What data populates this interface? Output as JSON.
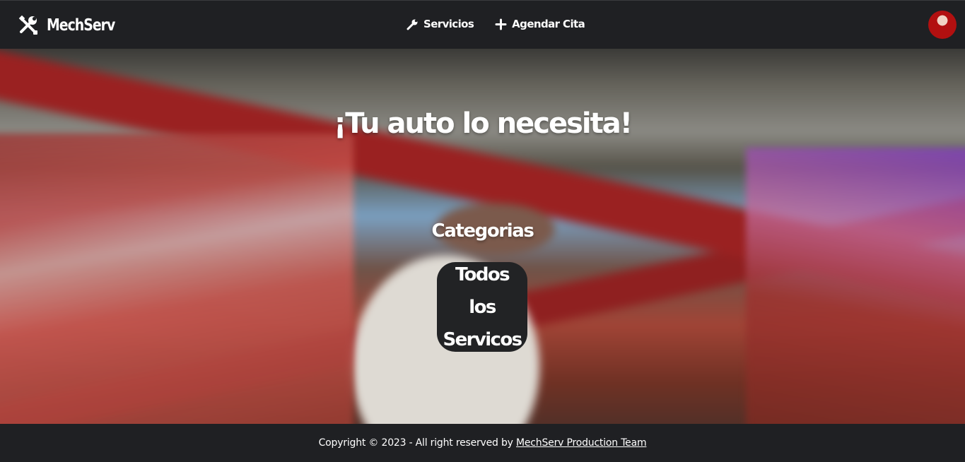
{
  "navbar": {
    "brand": "MechServ",
    "brand_icon": "tools-icon",
    "links": [
      {
        "label": "Servicios",
        "icon": "wrench-icon"
      },
      {
        "label": "Agendar Cita",
        "icon": "plus-icon"
      }
    ],
    "avatar_icon": "user-avatar"
  },
  "hero": {
    "title": "¡Tu auto lo necesita!",
    "section_title": "Categorias",
    "category_button": "Todos los Servicos"
  },
  "footer": {
    "copyright": "Copyright © 2023 - All right reserved by ",
    "link": "MechServ Production Team"
  },
  "colors": {
    "navbar_bg": "#1f2023",
    "button_bg": "#222325",
    "text": "#ffffff"
  }
}
